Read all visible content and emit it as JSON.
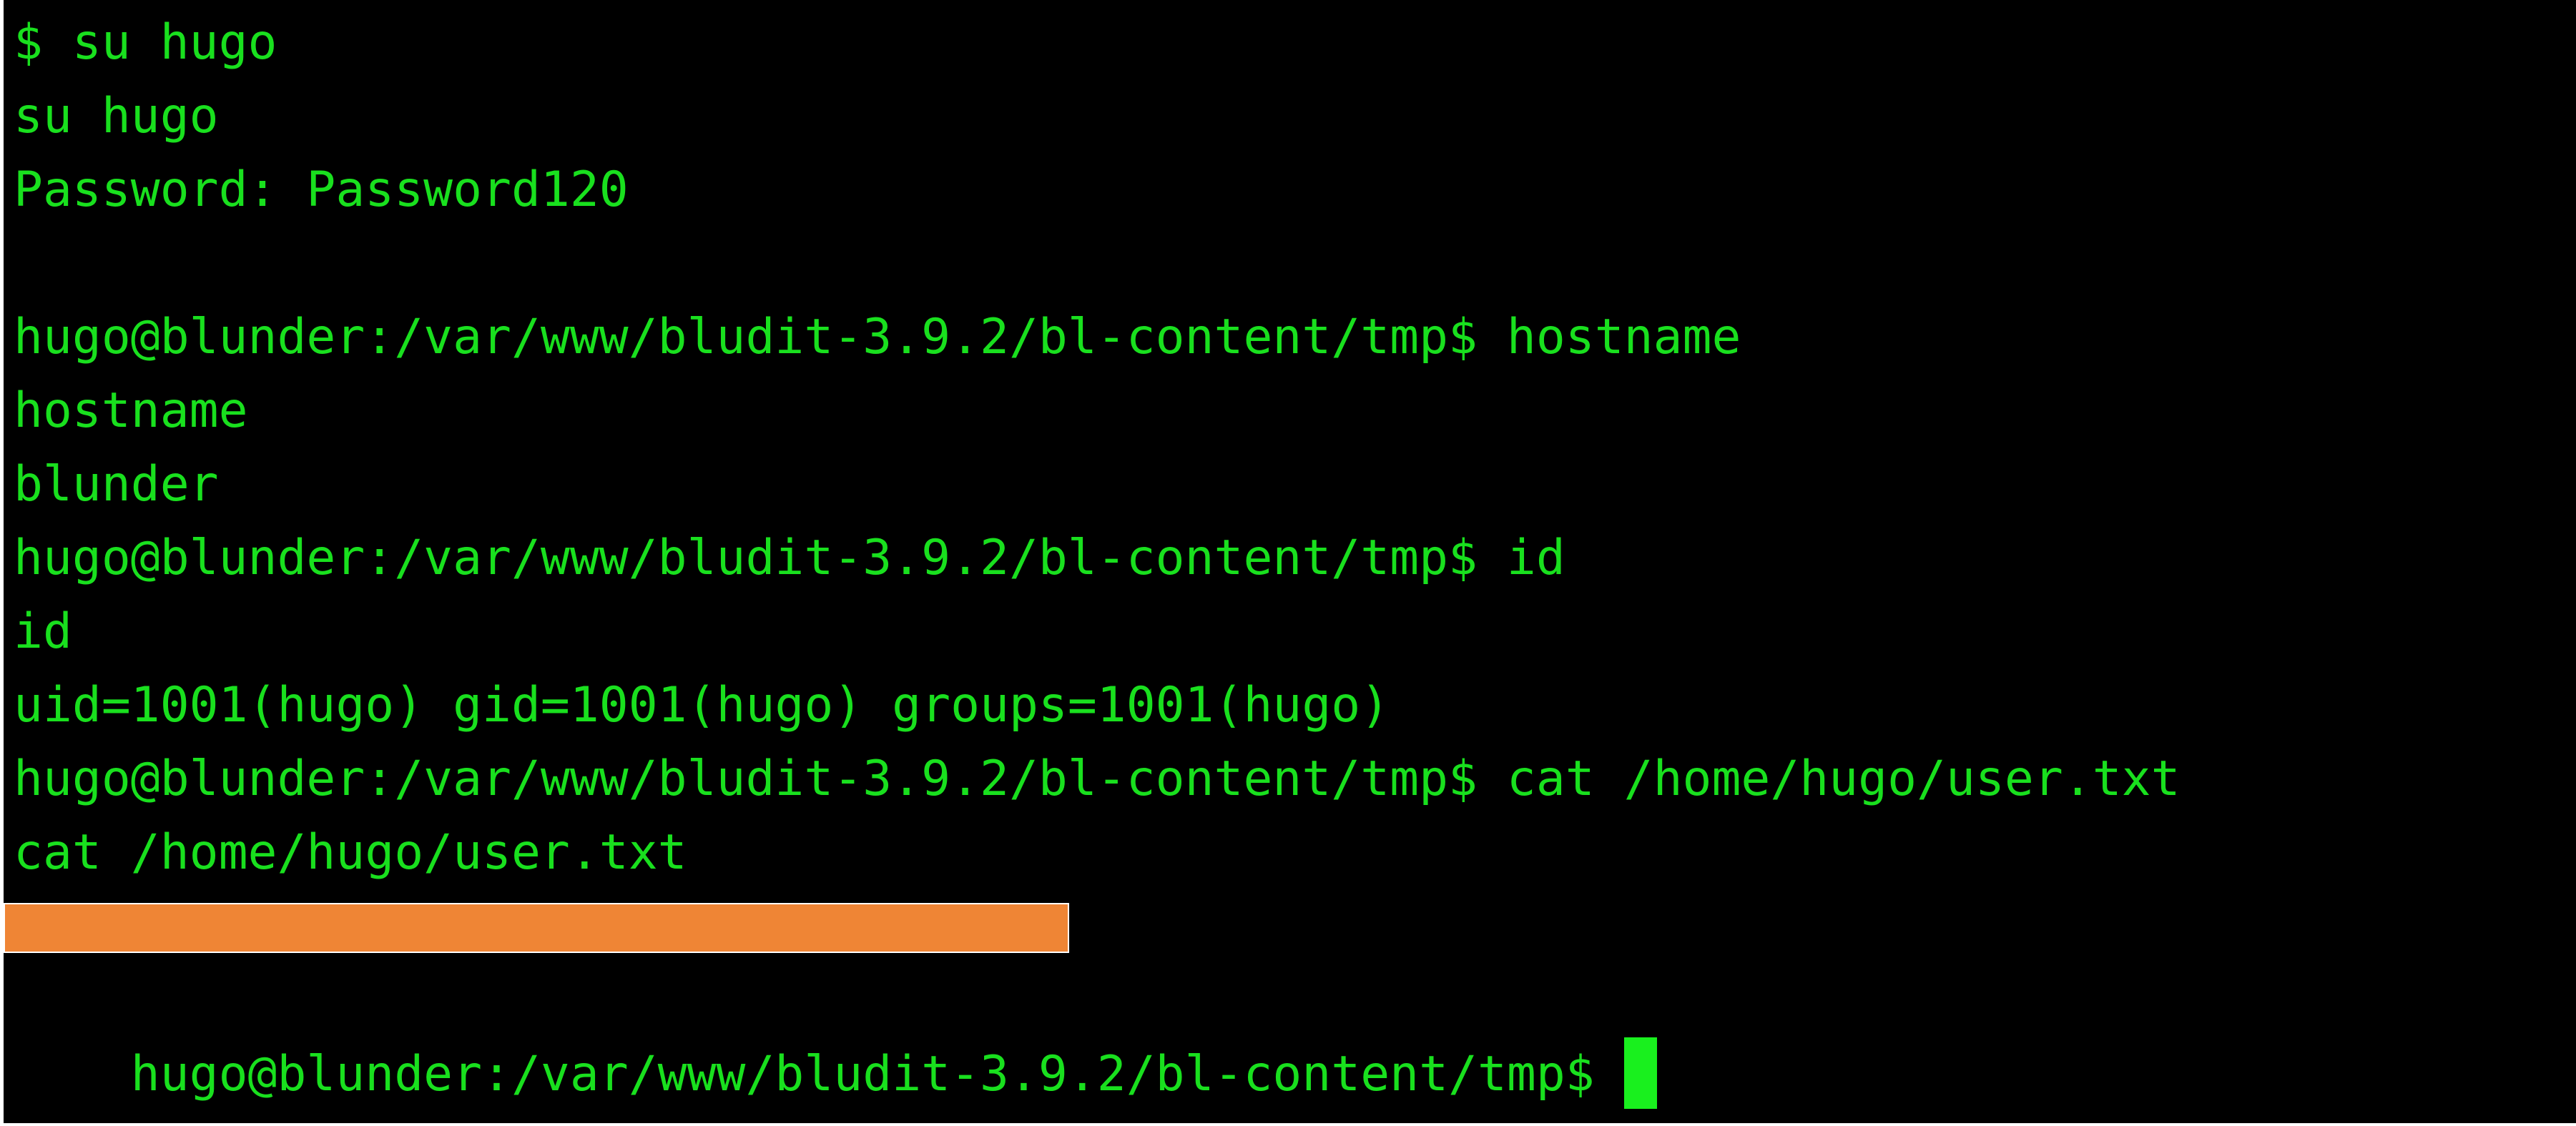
{
  "terminal": {
    "lines": [
      "$ su hugo",
      "su hugo",
      "Password: Password120",
      "",
      "hugo@blunder:/var/www/bludit-3.9.2/bl-content/tmp$ hostname",
      "hostname",
      "blunder",
      "hugo@blunder:/var/www/bludit-3.9.2/bl-content/tmp$ id",
      "id",
      "uid=1001(hugo) gid=1001(hugo) groups=1001(hugo)",
      "hugo@blunder:/var/www/bludit-3.9.2/bl-content/tmp$ cat /home/hugo/user.txt",
      "cat /home/hugo/user.txt"
    ],
    "prompt": "hugo@blunder:/var/www/bludit-3.9.2/bl-content/tmp$",
    "text_color": "#19e01e",
    "background_color": "#000000",
    "redaction_color": "#ef8535"
  }
}
